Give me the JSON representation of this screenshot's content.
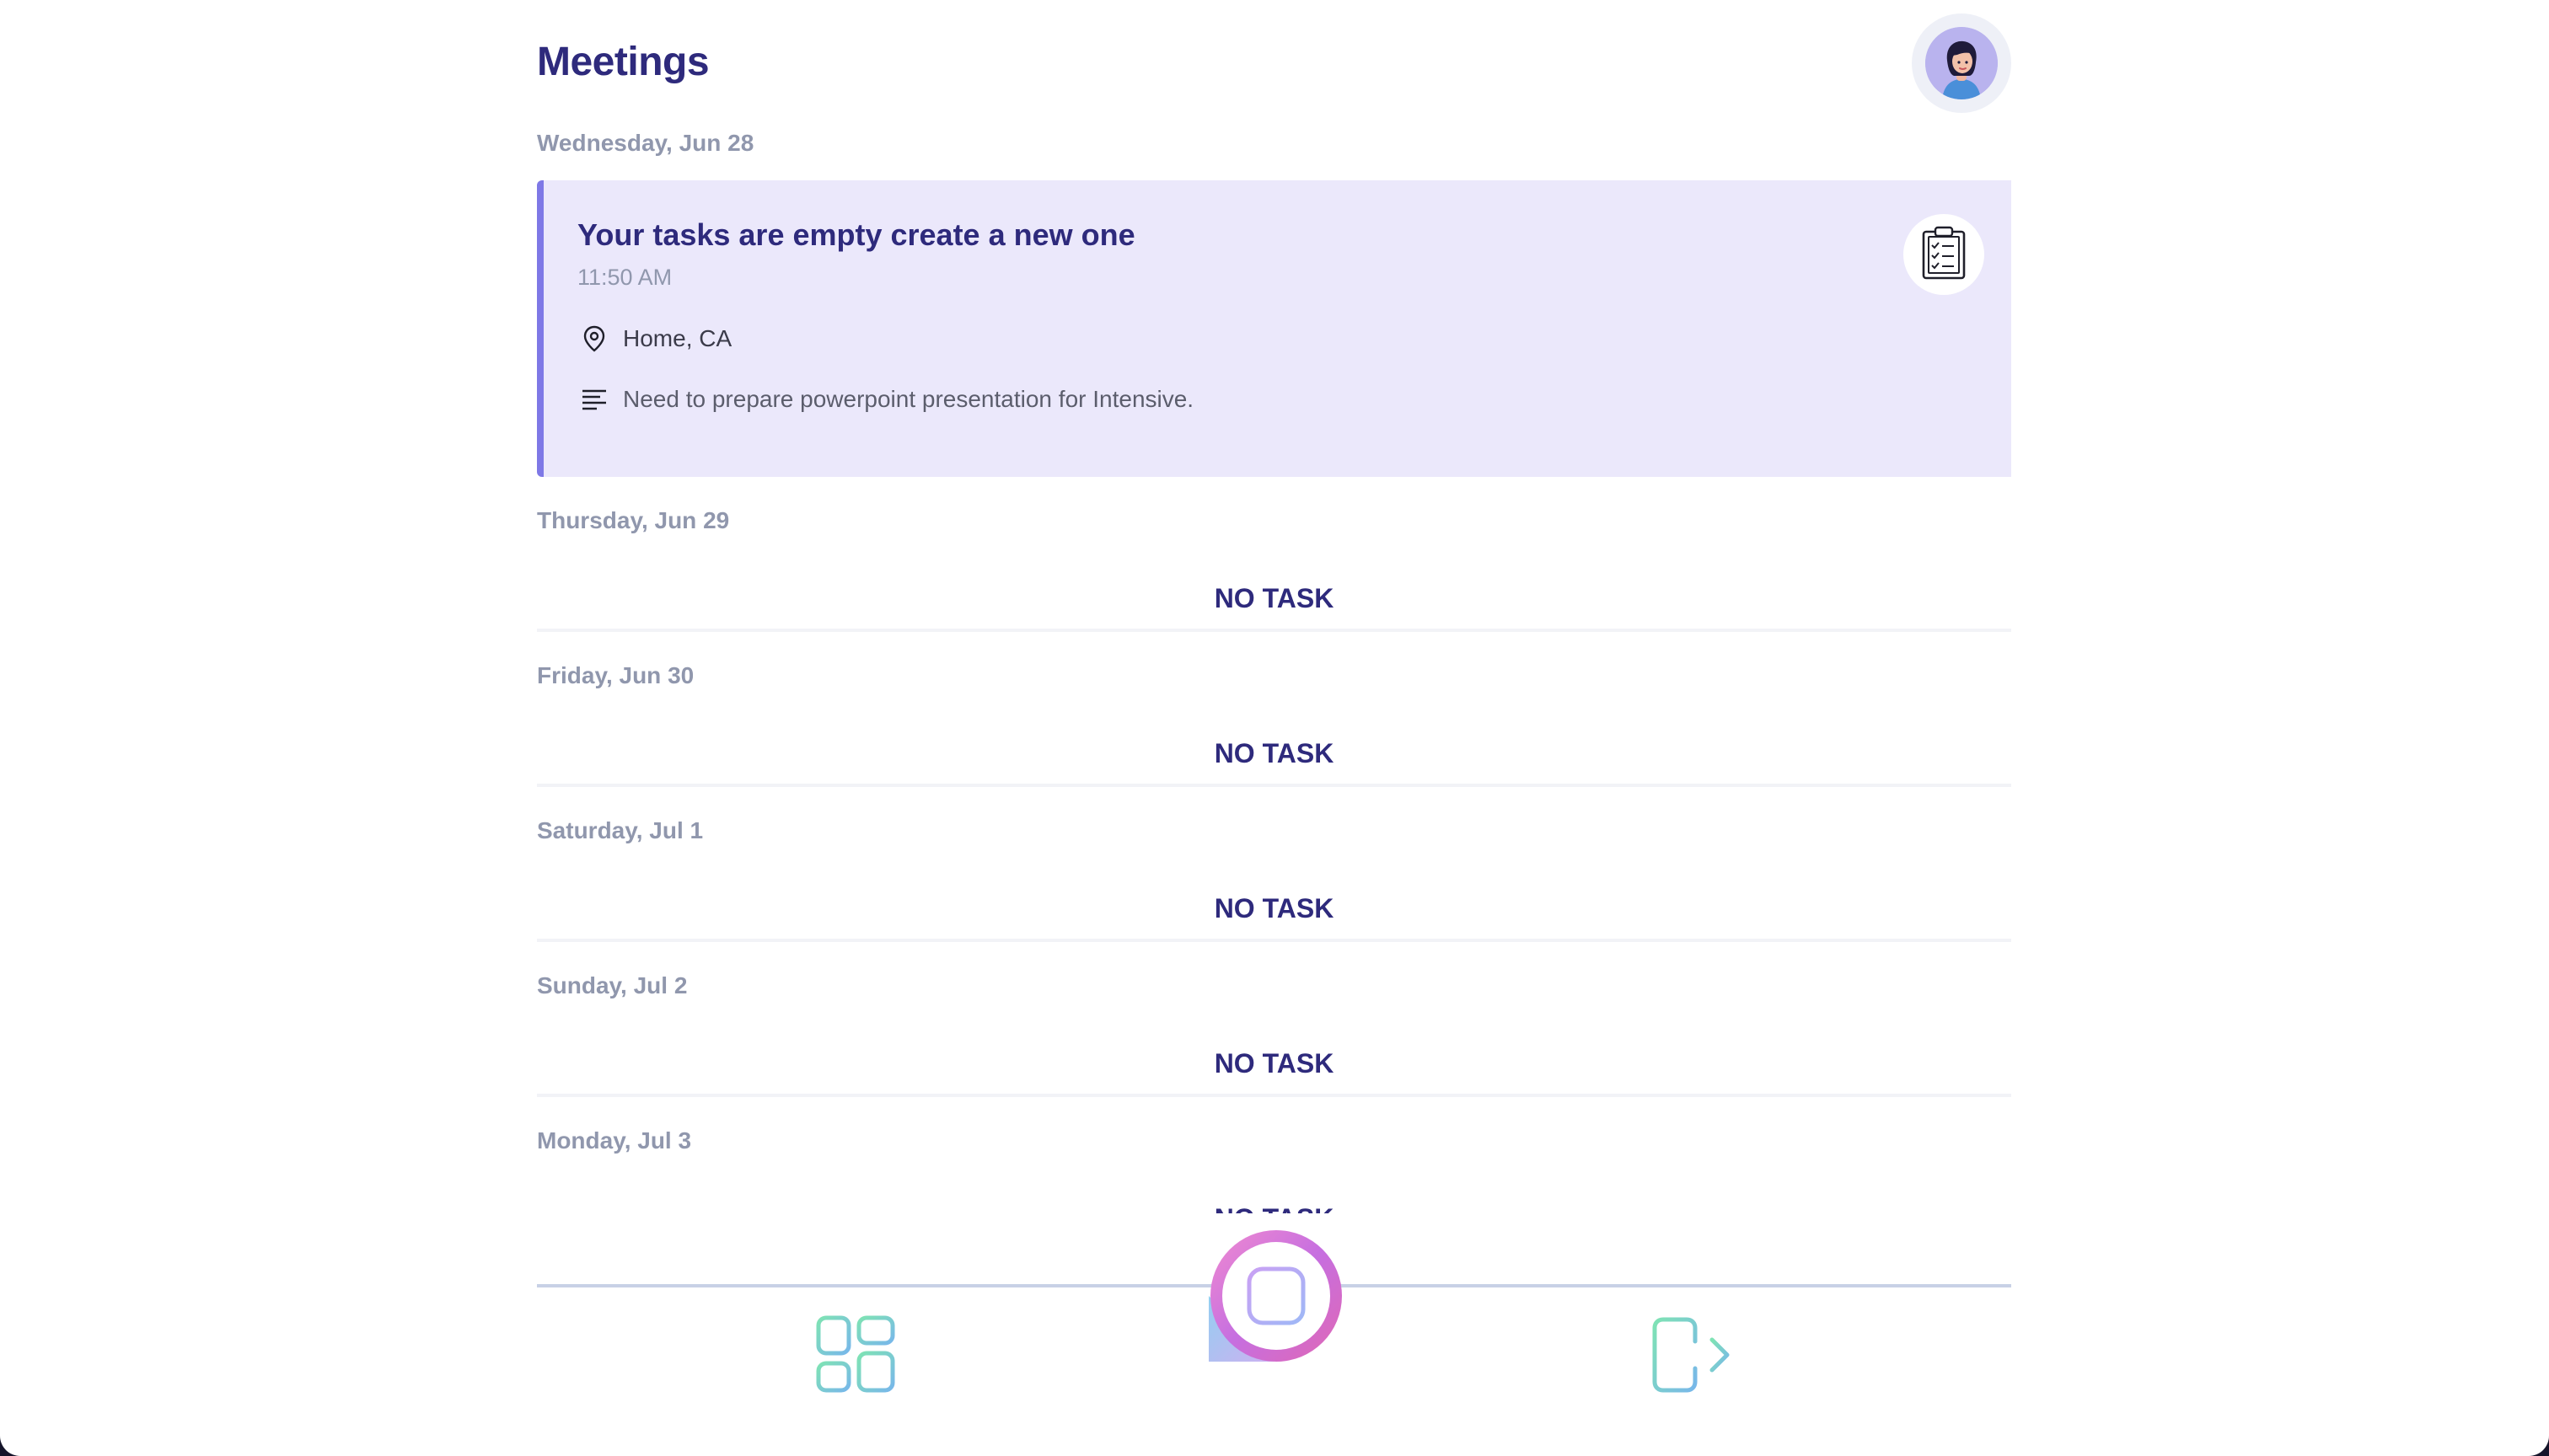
{
  "header": {
    "title": "Meetings",
    "avatar_icon": "user-avatar-icon"
  },
  "days": [
    {
      "label": "Wednesday, Jun 28",
      "task": {
        "title": "Your tasks are empty create a new one",
        "time": "11:50 AM",
        "location": "Home, CA",
        "description": "Need to prepare powerpoint presentation for Intensive.",
        "icon": "clipboard-checklist-icon"
      }
    },
    {
      "label": "Thursday, Jun 29",
      "empty_text": "NO TASK"
    },
    {
      "label": "Friday, Jun 30",
      "empty_text": "NO TASK"
    },
    {
      "label": "Saturday, Jul 1",
      "empty_text": "NO TASK"
    },
    {
      "label": "Sunday, Jul 2",
      "empty_text": "NO TASK"
    },
    {
      "label": "Monday, Jul 3",
      "empty_text": "NO TASK"
    }
  ],
  "bottom_nav": {
    "items": [
      "dashboard-grid-icon",
      "add-task-icon",
      "logout-icon"
    ]
  },
  "colors": {
    "primary": "#2e2a7c",
    "card_bg": "#ebe8fb",
    "card_accent": "#7e78e6",
    "muted": "#9097ad"
  }
}
